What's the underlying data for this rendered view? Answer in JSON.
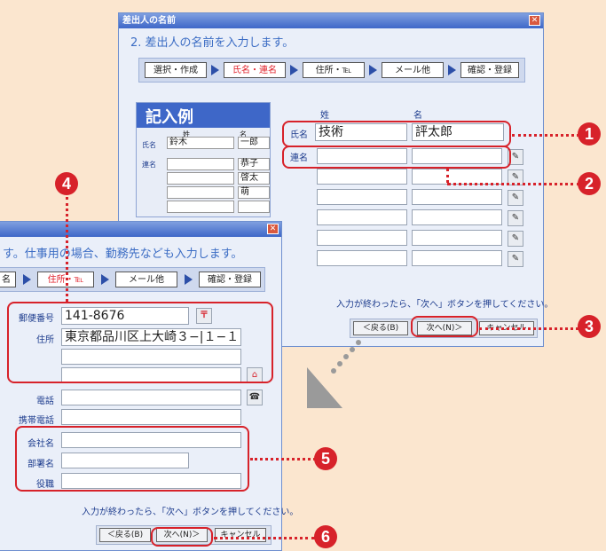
{
  "window1": {
    "title": "差出人の名前",
    "heading": "2. 差出人の名前を入力します。",
    "steps": [
      "選択・作成",
      "氏名・連名",
      "住所・℡",
      "メール他",
      "確認・登録"
    ],
    "example": {
      "title": "記入例",
      "col_sei": "姓",
      "col_mei": "名",
      "label_name": "氏名",
      "label_renmei": "連名",
      "sei_value": "鈴木",
      "mei_value": "一郎",
      "renmei_values": [
        "恭子",
        "啓太",
        "萌",
        ""
      ]
    },
    "form": {
      "col_sei": "姓",
      "col_mei": "名",
      "label_name": "氏名",
      "label_renmei": "連名",
      "sei_value": "技術",
      "mei_value": "評太郎"
    },
    "note": "入力が終わったら、「次へ」ボタンを押してください。",
    "buttons": {
      "back": "＜戻る(B)",
      "next": "次へ(N)＞",
      "cancel": "キャンセル"
    }
  },
  "window2": {
    "heading": "す。仕事用の場合、勤務先なども入力します。",
    "steps": [
      "名",
      "住所・℡",
      "メール他",
      "確認・登録"
    ],
    "labels": {
      "postal": "郵便番号",
      "address": "住所",
      "phone": "電話",
      "mobile": "携帯電話",
      "company": "会社名",
      "department": "部署名",
      "position": "役職"
    },
    "values": {
      "postal": "141-8676",
      "address": "東京都品川区上大崎３−|１−１"
    },
    "note": "入力が終わったら、「次へ」ボタンを押してください。",
    "buttons": {
      "back": "＜戻る(B)",
      "next": "次へ(N)＞",
      "cancel": "キャンセル"
    }
  },
  "callouts": [
    "1",
    "2",
    "3",
    "4",
    "5",
    "6"
  ],
  "colors": {
    "accent_red": "#d7222a",
    "title_blue": "#3e67c8",
    "background": "#fbe6cf"
  }
}
